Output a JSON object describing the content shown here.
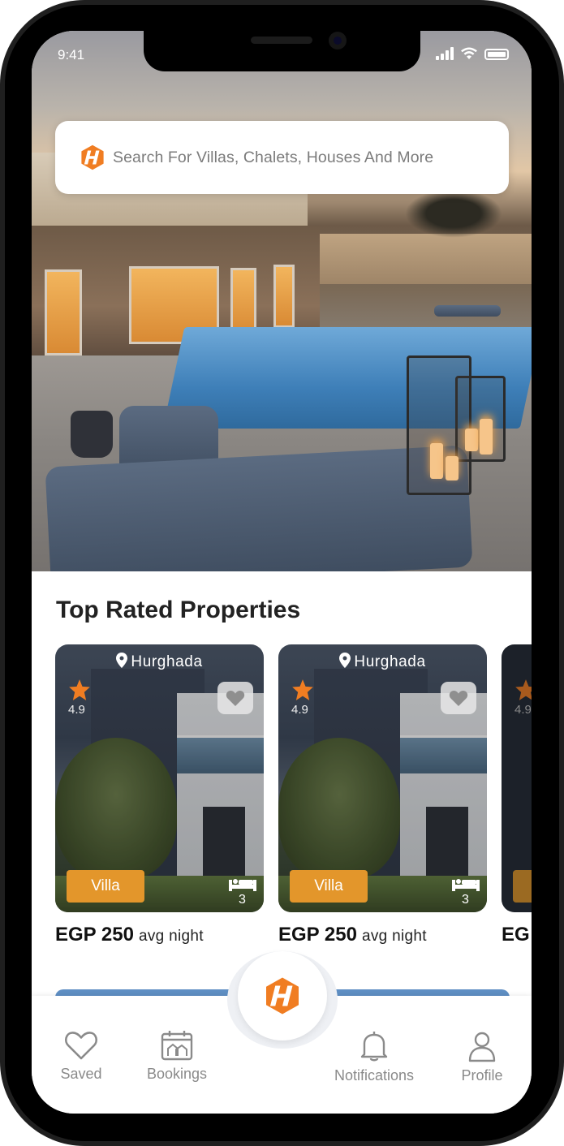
{
  "status_bar": {
    "time": "9:41"
  },
  "search": {
    "placeholder": "Search For Villas, Chalets, Houses And More"
  },
  "section": {
    "title": "Top Rated Properties"
  },
  "properties": [
    {
      "location": "Hurghada",
      "rating": "4.9",
      "type": "Villa",
      "beds": "3",
      "price": "EGP 250",
      "price_unit": "avg night"
    },
    {
      "location": "Hurghada",
      "rating": "4.9",
      "type": "Villa",
      "beds": "3",
      "price": "EGP 250",
      "price_unit": "avg night"
    },
    {
      "location": "",
      "rating": "4.9",
      "type": "",
      "beds": "",
      "price": "EG",
      "price_unit": ""
    }
  ],
  "tabbar": {
    "saved": "Saved",
    "bookings": "Bookings",
    "notifications": "Notifications",
    "profile": "Profile"
  },
  "colors": {
    "brand_orange": "#f07d22",
    "badge_orange": "#e3962b",
    "tab_gray": "#8a8a8a"
  },
  "icons": [
    "logo-icon",
    "location-pin-icon",
    "star-icon",
    "heart-icon",
    "bed-icon",
    "calendar-house-icon",
    "bell-icon",
    "profile-icon",
    "signal-icon",
    "wifi-icon",
    "battery-icon"
  ]
}
